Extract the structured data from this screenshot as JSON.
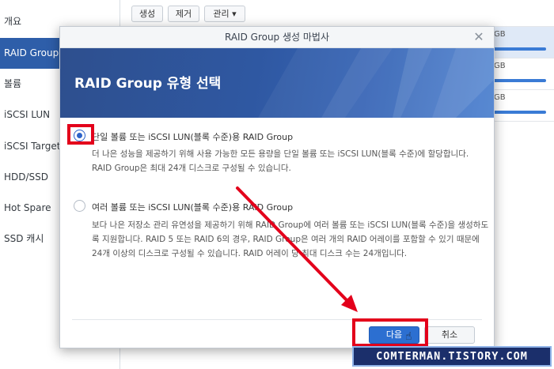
{
  "sidebar": {
    "items": [
      {
        "label": "개요"
      },
      {
        "label": "RAID Group",
        "active": true
      },
      {
        "label": "볼륨"
      },
      {
        "label": "iSCSI LUN"
      },
      {
        "label": "iSCSI Target"
      },
      {
        "label": "HDD/SSD"
      },
      {
        "label": "Hot Spare"
      },
      {
        "label": "SSD 캐시"
      }
    ]
  },
  "toolbar": {
    "create_label": "생성",
    "remove_label": "제거",
    "manage_label": "관리 ▾"
  },
  "background_rows": [
    {
      "size": "GB"
    },
    {
      "size": "GB"
    },
    {
      "size": "GB"
    }
  ],
  "modal": {
    "title": "RAID Group 생성 마법사",
    "banner_title": "RAID Group 유형 선택",
    "options": [
      {
        "label": "단일 볼륨 또는 iSCSI LUN(블록 수준)용 RAID Group",
        "selected": true,
        "desc_lines": [
          "더 나은 성능을 제공하기 위해 사용 가능한 모든 용량을 단일 볼륨 또는 iSCSI LUN(블록 수준)에 할당합니다.",
          "RAID Group은 최대 24개 디스크로 구성될 수 있습니다."
        ]
      },
      {
        "label": "여러 볼륨 또는 iSCSI LUN(블록 수준)용 RAID Group",
        "selected": false,
        "desc_lines": [
          "보다 나은 저장소 관리 유연성을 제공하기 위해 RAID Group에 여러 볼륨 또는 iSCSI LUN(블록 수준)을 생성하도",
          "록 지원합니다. RAID 5 또는 RAID 6의 경우, RAID Group은 여러 개의 RAID 어레이를 포함할 수 있기 때문에",
          "24개 이상의 디스크로 구성될 수 있습니다. RAID 어레이 당 최대 디스크 수는 24개입니다."
        ]
      }
    ],
    "next_label": "다음",
    "cancel_label": "취소"
  },
  "watermark": "COMTERMAN.TISTORY.COM",
  "colors": {
    "accent": "#2c6fd1",
    "sidebar_active": "#2e5ea9",
    "annotation_red": "#e3001b"
  }
}
